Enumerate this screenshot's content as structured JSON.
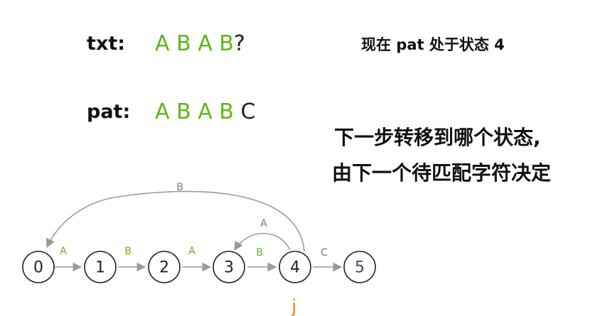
{
  "txt": {
    "label": "txt:",
    "chars": [
      "A",
      "B",
      "A",
      "B"
    ],
    "unknown": "?"
  },
  "pat": {
    "label": "pat:",
    "chars": [
      "A",
      "B",
      "A",
      "B"
    ],
    "next": "C"
  },
  "note_state": "现在 pat 处于状态 4",
  "note_line1": "下一步转移到哪个状态,",
  "note_line2": "由下一个待匹配字符决定",
  "states": [
    "0",
    "1",
    "2",
    "3",
    "4",
    "5"
  ],
  "edges": [
    {
      "from": "0",
      "to": "1",
      "label": "A"
    },
    {
      "from": "1",
      "to": "2",
      "label": "B"
    },
    {
      "from": "2",
      "to": "3",
      "label": "A"
    },
    {
      "from": "3",
      "to": "4",
      "label": "B"
    },
    {
      "from": "4",
      "to": "5",
      "label": "C"
    },
    {
      "from": "4",
      "to": "3",
      "label": "A"
    },
    {
      "from": "4",
      "to": "0",
      "label": "B"
    }
  ],
  "pointer": "j",
  "colors": {
    "match": "#5cb811",
    "arrow": "#9a9a9a",
    "pointer": "#f08a1c"
  }
}
